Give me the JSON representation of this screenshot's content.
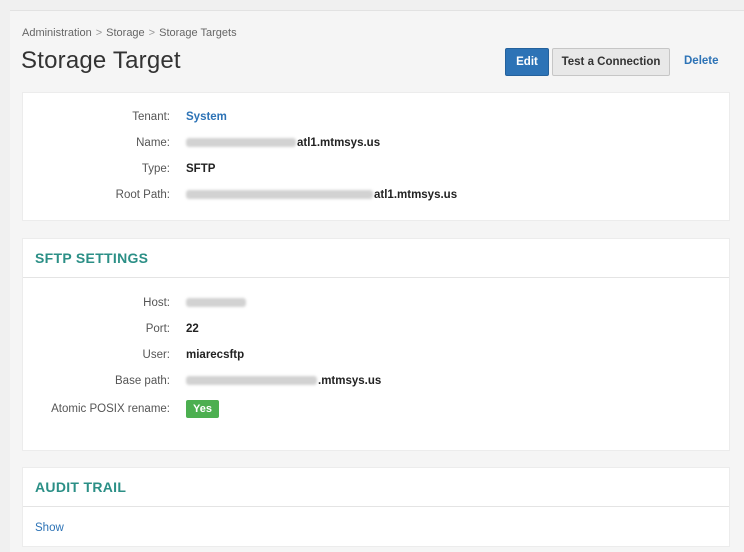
{
  "breadcrumb": {
    "items": [
      "Administration",
      "Storage",
      "Storage Targets"
    ],
    "separator": ">"
  },
  "page": {
    "title": "Storage Target"
  },
  "actions": {
    "edit_label": "Edit",
    "test_label": "Test a Connection",
    "delete_label": "Delete"
  },
  "details": {
    "tenant_label": "Tenant:",
    "tenant_value": "System",
    "name_label": "Name:",
    "name_visible_suffix": "atl1.mtmsys.us",
    "type_label": "Type:",
    "type_value": "SFTP",
    "root_path_label": "Root Path:",
    "root_path_visible_suffix": "atl1.mtmsys.us"
  },
  "sftp": {
    "header": "SFTP SETTINGS",
    "host_label": "Host:",
    "port_label": "Port:",
    "port_value": "22",
    "user_label": "User:",
    "user_value": "miarecsftp",
    "base_path_label": "Base path:",
    "base_path_visible_suffix": ".mtmsys.us",
    "atomic_label": "Atomic POSIX rename:",
    "atomic_value": "Yes"
  },
  "audit": {
    "header": "AUDIT TRAIL",
    "show_label": "Show"
  },
  "colors": {
    "accent_blue": "#2d73b6",
    "section_teal": "#2b8f86",
    "badge_green": "#4caf50"
  }
}
